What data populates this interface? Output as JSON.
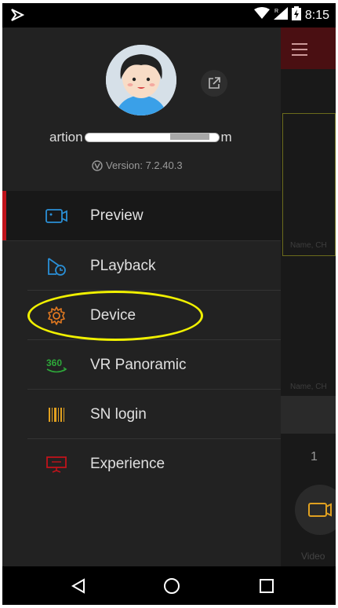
{
  "status_bar": {
    "time": "8:15"
  },
  "drawer": {
    "account_prefix": "artion",
    "account_suffix": "m",
    "version": "Version: 7.2.40.3",
    "menu": [
      {
        "label": "Preview",
        "icon": "camera-icon",
        "color": "#2a8fd6",
        "active": true
      },
      {
        "label": "PLayback",
        "icon": "playback-icon",
        "color": "#2a8fd6",
        "active": false
      },
      {
        "label": "Device",
        "icon": "gear-icon",
        "color": "#e07820",
        "active": false
      },
      {
        "label": "VR Panoramic",
        "icon": "vr-360-icon",
        "color": "#2ea83a",
        "active": false
      },
      {
        "label": "SN login",
        "icon": "barcode-icon",
        "color": "#e0a020",
        "active": false
      },
      {
        "label": "Experience",
        "icon": "presentation-icon",
        "color": "#c0131b",
        "active": false
      }
    ]
  },
  "background_app": {
    "name_label_1": "Name, CH",
    "name_label_2": "Name, CH",
    "channel_number": "1",
    "video_label": "Video"
  },
  "colors": {
    "accent_red": "#c0131b",
    "drawer_bg": "#222222",
    "highlight": "#f0f000"
  }
}
